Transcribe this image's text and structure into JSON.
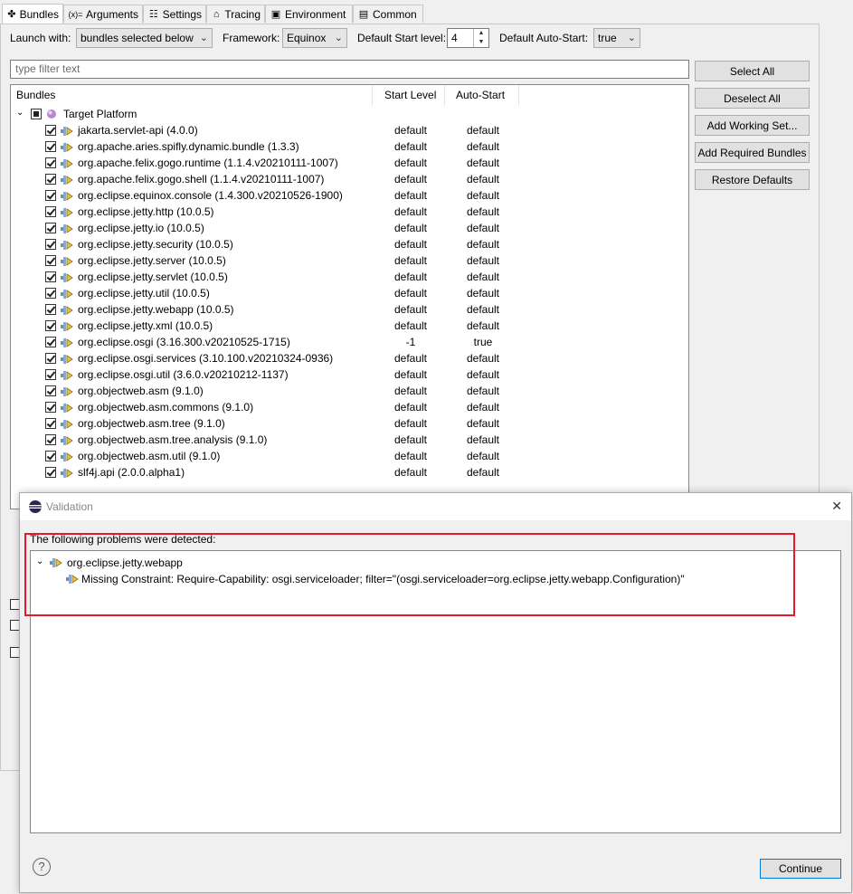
{
  "tabs": [
    {
      "label": "Bundles",
      "icon": "bundles-icon",
      "active": true
    },
    {
      "label": "Arguments",
      "icon": "arguments-icon"
    },
    {
      "label": "Settings",
      "icon": "settings-icon"
    },
    {
      "label": "Tracing",
      "icon": "tracing-icon"
    },
    {
      "label": "Environment",
      "icon": "environment-icon"
    },
    {
      "label": "Common",
      "icon": "common-icon"
    }
  ],
  "toolbar": {
    "launch_with_label": "Launch with:",
    "launch_with_value": "bundles selected below",
    "framework_label": "Framework:",
    "framework_value": "Equinox",
    "start_level_label": "Default Start level:",
    "start_level_value": "4",
    "auto_start_label": "Default Auto-Start:",
    "auto_start_value": "true"
  },
  "filter": {
    "placeholder": "type filter text"
  },
  "buttons": {
    "select_all": "Select All",
    "deselect_all": "Deselect All",
    "add_working_set": "Add Working Set...",
    "add_required": "Add Required Bundles",
    "restore_defaults": "Restore Defaults"
  },
  "tree": {
    "columns": [
      "Bundles",
      "Start Level",
      "Auto-Start"
    ],
    "root": "Target Platform",
    "bundles": [
      {
        "name": "jakarta.servlet-api (4.0.0)",
        "level": "default",
        "auto": "default"
      },
      {
        "name": "org.apache.aries.spifly.dynamic.bundle (1.3.3)",
        "level": "default",
        "auto": "default"
      },
      {
        "name": "org.apache.felix.gogo.runtime (1.1.4.v20210111-1007)",
        "level": "default",
        "auto": "default"
      },
      {
        "name": "org.apache.felix.gogo.shell (1.1.4.v20210111-1007)",
        "level": "default",
        "auto": "default"
      },
      {
        "name": "org.eclipse.equinox.console (1.4.300.v20210526-1900)",
        "level": "default",
        "auto": "default"
      },
      {
        "name": "org.eclipse.jetty.http (10.0.5)",
        "level": "default",
        "auto": "default"
      },
      {
        "name": "org.eclipse.jetty.io (10.0.5)",
        "level": "default",
        "auto": "default"
      },
      {
        "name": "org.eclipse.jetty.security (10.0.5)",
        "level": "default",
        "auto": "default"
      },
      {
        "name": "org.eclipse.jetty.server (10.0.5)",
        "level": "default",
        "auto": "default"
      },
      {
        "name": "org.eclipse.jetty.servlet (10.0.5)",
        "level": "default",
        "auto": "default"
      },
      {
        "name": "org.eclipse.jetty.util (10.0.5)",
        "level": "default",
        "auto": "default"
      },
      {
        "name": "org.eclipse.jetty.webapp (10.0.5)",
        "level": "default",
        "auto": "default"
      },
      {
        "name": "org.eclipse.jetty.xml (10.0.5)",
        "level": "default",
        "auto": "default"
      },
      {
        "name": "org.eclipse.osgi (3.16.300.v20210525-1715)",
        "level": "-1",
        "auto": "true"
      },
      {
        "name": "org.eclipse.osgi.services (3.10.100.v20210324-0936)",
        "level": "default",
        "auto": "default"
      },
      {
        "name": "org.eclipse.osgi.util (3.6.0.v20210212-1137)",
        "level": "default",
        "auto": "default"
      },
      {
        "name": "org.objectweb.asm (9.1.0)",
        "level": "default",
        "auto": "default"
      },
      {
        "name": "org.objectweb.asm.commons (9.1.0)",
        "level": "default",
        "auto": "default"
      },
      {
        "name": "org.objectweb.asm.tree (9.1.0)",
        "level": "default",
        "auto": "default"
      },
      {
        "name": "org.objectweb.asm.tree.analysis (9.1.0)",
        "level": "default",
        "auto": "default"
      },
      {
        "name": "org.objectweb.asm.util (9.1.0)",
        "level": "default",
        "auto": "default"
      },
      {
        "name": "slf4j.api (2.0.0.alpha1)",
        "level": "default",
        "auto": "default"
      }
    ]
  },
  "dialog": {
    "title": "Validation",
    "heading": "The following problems were detected:",
    "problem_bundle": "org.eclipse.jetty.webapp",
    "problem_detail": "Missing Constraint: Require-Capability: osgi.serviceloader; filter=\"(osgi.serviceloader=org.eclipse.jetty.webapp.Configuration)\"",
    "continue_label": "Continue",
    "help_glyph": "?",
    "close_glyph": "✕"
  },
  "colors": {
    "highlight": "#e11b2d",
    "accent_border": "#0078d7"
  }
}
